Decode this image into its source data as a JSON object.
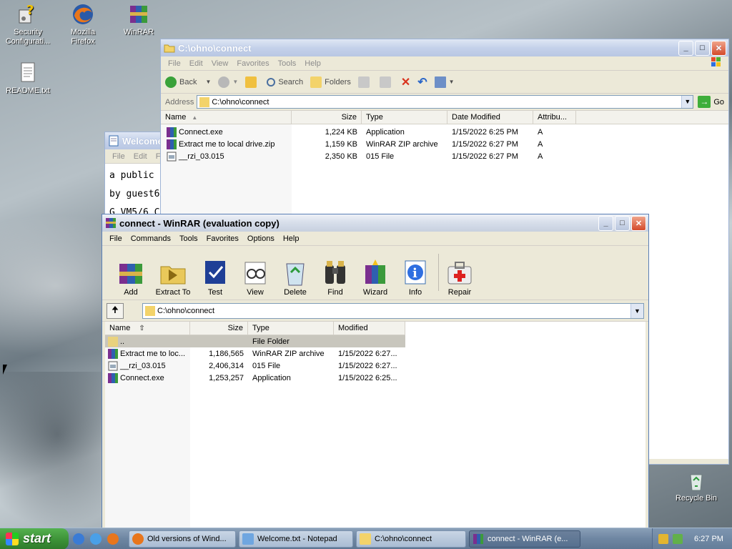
{
  "desktop": {
    "icons": [
      {
        "label": "Security Configurati...",
        "icon": "security-config-icon"
      },
      {
        "label": "Mozilla Firefox",
        "icon": "firefox-icon"
      },
      {
        "label": "WinRAR",
        "icon": "winrar-icon"
      },
      {
        "label": "README.txt",
        "icon": "text-file-icon"
      },
      {
        "label": "Recycle Bin",
        "icon": "recycle-bin-icon"
      }
    ]
  },
  "notepad": {
    "title": "Welcome.txt - Notepad",
    "title_visible": "Welcome",
    "menu": [
      "File",
      "Edit",
      "Fo"
    ],
    "lines": [
      "a public",
      "by guest6",
      "G VM5/6 C"
    ]
  },
  "explorer": {
    "title": "C:\\ohno\\connect",
    "menu": [
      "File",
      "Edit",
      "View",
      "Favorites",
      "Tools",
      "Help"
    ],
    "toolbar": {
      "back": "Back",
      "search": "Search",
      "folders": "Folders"
    },
    "address_label": "Address",
    "address_value": "C:\\ohno\\connect",
    "go_label": "Go",
    "columns": [
      "Name",
      "Size",
      "Type",
      "Date Modified",
      "Attribu..."
    ],
    "files": [
      {
        "name": "Connect.exe",
        "size": "1,224 KB",
        "type": "Application",
        "date": "1/15/2022 6:25 PM",
        "attr": "A"
      },
      {
        "name": "Extract me to local drive.zip",
        "size": "1,159 KB",
        "type": "WinRAR ZIP archive",
        "date": "1/15/2022 6:27 PM",
        "attr": "A"
      },
      {
        "name": "__rzi_03.015",
        "size": "2,350 KB",
        "type": "015 File",
        "date": "1/15/2022 6:27 PM",
        "attr": "A"
      }
    ]
  },
  "winrar": {
    "title": "connect - WinRAR (evaluation copy)",
    "menu": [
      "File",
      "Commands",
      "Tools",
      "Favorites",
      "Options",
      "Help"
    ],
    "buttons": [
      "Add",
      "Extract To",
      "Test",
      "View",
      "Delete",
      "Find",
      "Wizard",
      "Info",
      "Repair"
    ],
    "path": "C:\\ohno\\connect",
    "columns": [
      "Name",
      "Size",
      "Type",
      "Modified"
    ],
    "files": [
      {
        "name": "..",
        "size": "",
        "type": "File Folder",
        "modified": ""
      },
      {
        "name": "Extract me to loc...",
        "size": "1,186,565",
        "type": "WinRAR ZIP archive",
        "modified": "1/15/2022 6:27..."
      },
      {
        "name": "__rzi_03.015",
        "size": "2,406,314",
        "type": "015 File",
        "modified": "1/15/2022 6:27..."
      },
      {
        "name": "Connect.exe",
        "size": "1,253,257",
        "type": "Application",
        "modified": "1/15/2022 6:25..."
      }
    ]
  },
  "taskbar": {
    "start_label": "start",
    "tasks": [
      {
        "label": "Old versions of Wind...",
        "active": false
      },
      {
        "label": "Welcome.txt - Notepad",
        "active": false
      },
      {
        "label": "C:\\ohno\\connect",
        "active": false
      },
      {
        "label": "connect - WinRAR (e...",
        "active": true
      }
    ],
    "clock": "6:27 PM"
  }
}
